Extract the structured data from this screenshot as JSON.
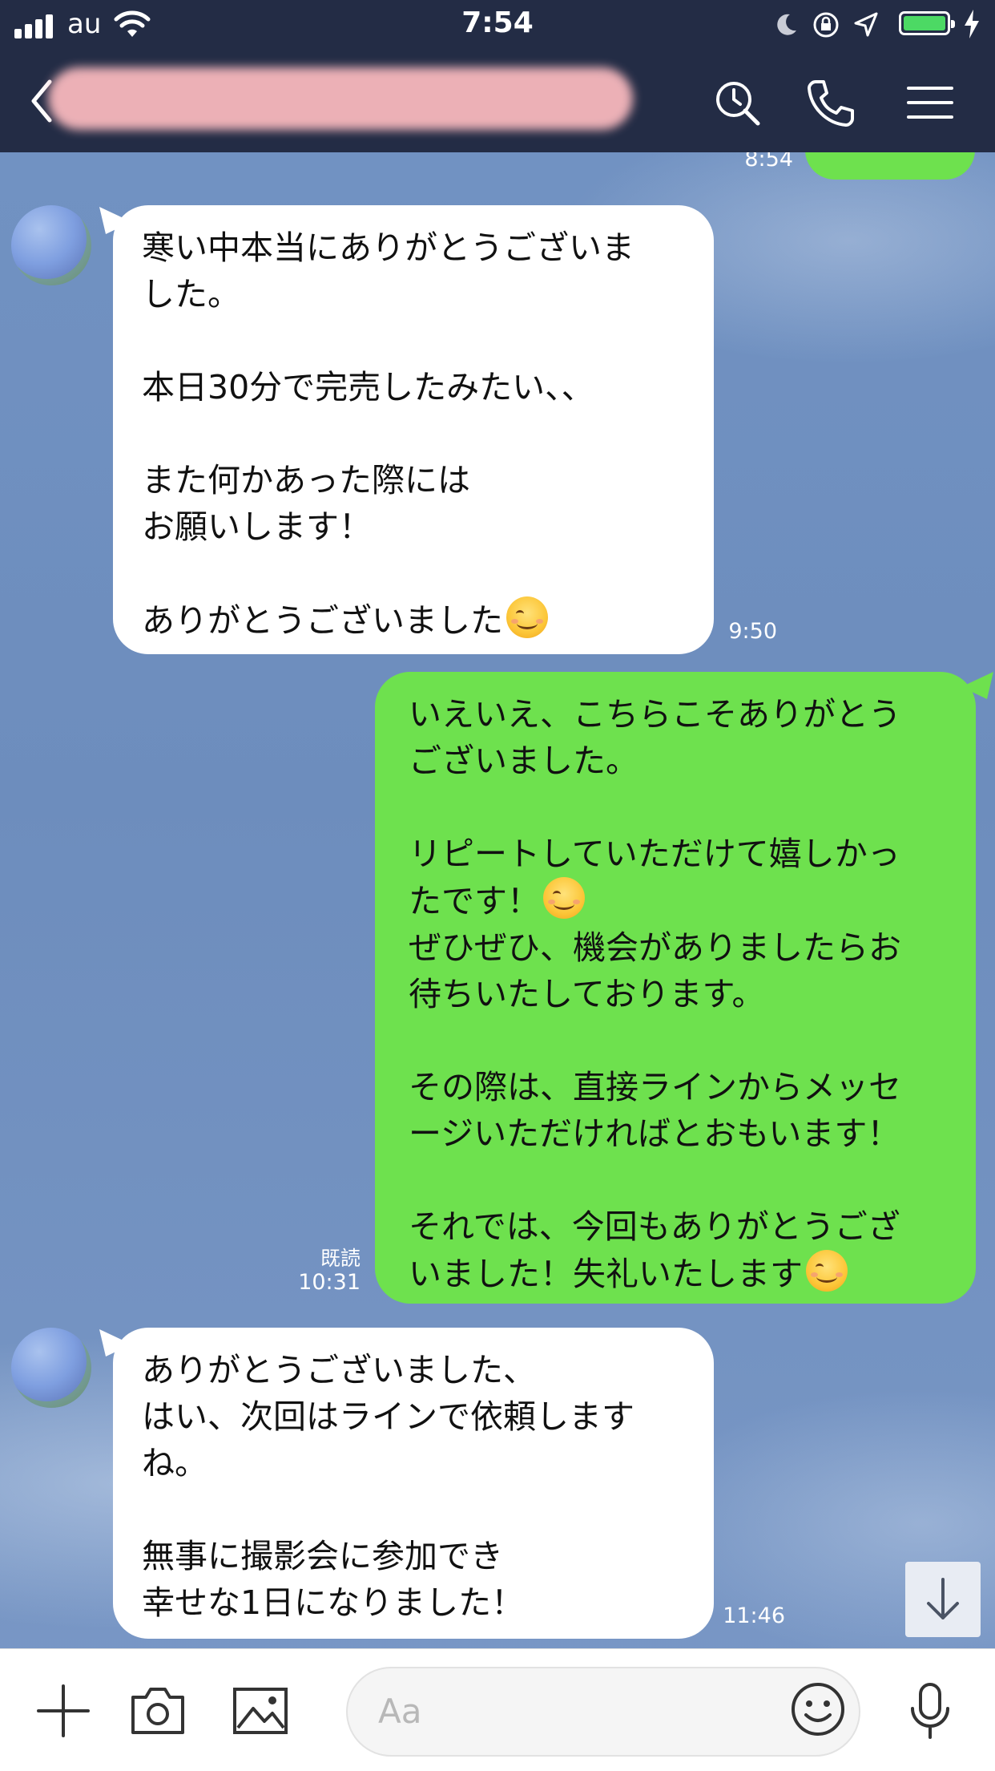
{
  "status_bar": {
    "time": "7:54",
    "carrier": "au"
  },
  "header": {
    "back_icon": "chevron-left-icon",
    "title_redacted": true,
    "icons": [
      "search-icon",
      "phone-icon",
      "menu-icon"
    ]
  },
  "messages": [
    {
      "id": "m0",
      "direction": "out",
      "time": "8:54",
      "text": ""
    },
    {
      "id": "m1",
      "direction": "in",
      "time": "9:50",
      "text": "寒い中本当にありがとうございま\nした。\n\n本日30分で完売したみたい、、\n\nまた何かあった際には\nお願いします！\n\nありがとうございました"
    },
    {
      "id": "m2",
      "direction": "out",
      "time": "10:31",
      "read": "既読",
      "text_a": "いえいえ、こちらこそありがとう\nございました。\n\nリピートしていただけて嬉しかっ\nたです！",
      "text_b": "ぜひぜひ、機会がありましたらお\n待ちいたしております。\n\nその際は、直接ラインからメッセ\nージいただければとおもいます！\n\nそれでは、今回もありがとうござ\nいました！失礼いたします"
    },
    {
      "id": "m3",
      "direction": "in",
      "time": "11:46",
      "text": "ありがとうございました、\nはい、次回はラインで依頼します\nね。\n\n無事に撮影会に参加でき\n幸せな1日になりました！"
    }
  ],
  "composer": {
    "placeholder": "Aa",
    "icons": [
      "plus-icon",
      "camera-icon",
      "image-icon",
      "emoji-icon",
      "microphone-icon"
    ]
  },
  "colors": {
    "header_bg": "#232c45",
    "outgoing_bubble": "#6ee14e",
    "incoming_bubble": "#ffffff",
    "battery": "#4cd964",
    "redaction": "#f7b8bd"
  }
}
